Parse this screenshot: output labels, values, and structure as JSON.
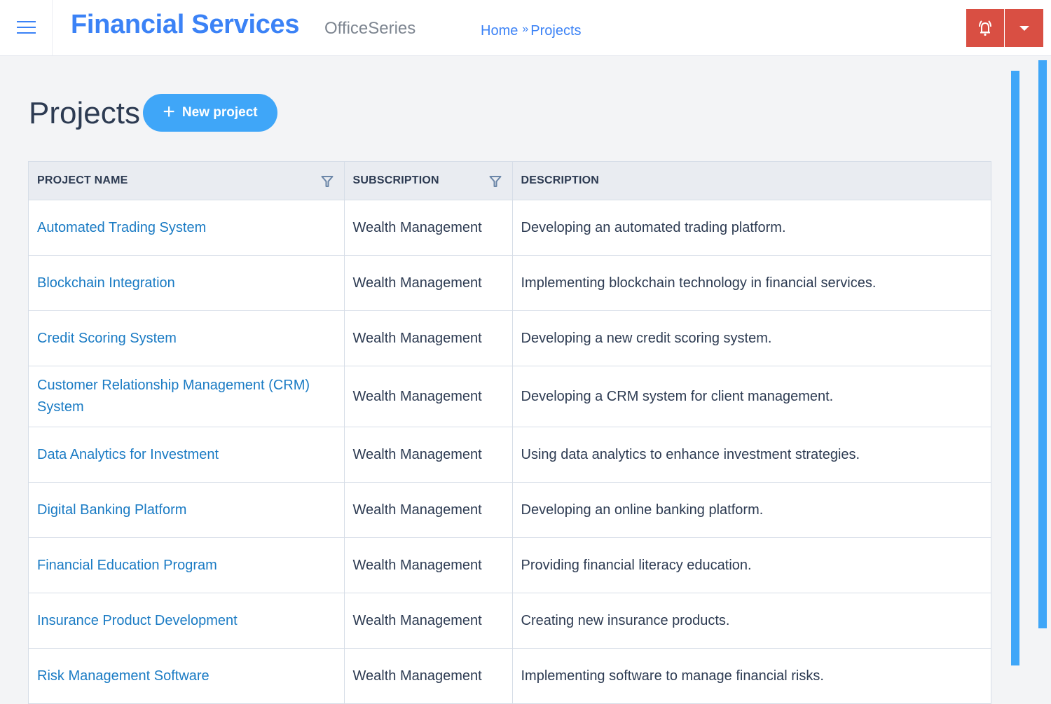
{
  "header": {
    "brand": "Financial Services",
    "sub_brand": "OfficeSeries",
    "breadcrumb": [
      {
        "label": "Home"
      },
      {
        "label": "Projects"
      }
    ],
    "breadcrumb_separator": "»",
    "menu_icon": "hamburger-icon",
    "alert_icon": "bell-icon",
    "dropdown_icon": "caret-down-icon",
    "accent_color": "#3b82f6",
    "alert_color": "#d94f43"
  },
  "page": {
    "title": "Projects",
    "new_button": {
      "label": "New project",
      "icon": "plus-icon"
    }
  },
  "table": {
    "columns": [
      {
        "label": "PROJECT NAME",
        "filter": true
      },
      {
        "label": "SUBSCRIPTION",
        "filter": true
      },
      {
        "label": "DESCRIPTION",
        "filter": false
      }
    ],
    "rows": [
      {
        "name": "Automated Trading System",
        "subscription": "Wealth Management",
        "description": "Developing an automated trading platform."
      },
      {
        "name": "Blockchain Integration",
        "subscription": "Wealth Management",
        "description": "Implementing blockchain technology in financial services."
      },
      {
        "name": "Credit Scoring System",
        "subscription": "Wealth Management",
        "description": "Developing a new credit scoring system."
      },
      {
        "name": "Customer Relationship Management (CRM) System",
        "subscription": "Wealth Management",
        "description": "Developing a CRM system for client management."
      },
      {
        "name": "Data Analytics for Investment",
        "subscription": "Wealth Management",
        "description": "Using data analytics to enhance investment strategies."
      },
      {
        "name": "Digital Banking Platform",
        "subscription": "Wealth Management",
        "description": "Developing an online banking platform."
      },
      {
        "name": "Financial Education Program",
        "subscription": "Wealth Management",
        "description": "Providing financial literacy education."
      },
      {
        "name": "Insurance Product Development",
        "subscription": "Wealth Management",
        "description": "Creating new insurance products."
      },
      {
        "name": "Risk Management Software",
        "subscription": "Wealth Management",
        "description": "Implementing software to manage financial risks."
      }
    ]
  }
}
